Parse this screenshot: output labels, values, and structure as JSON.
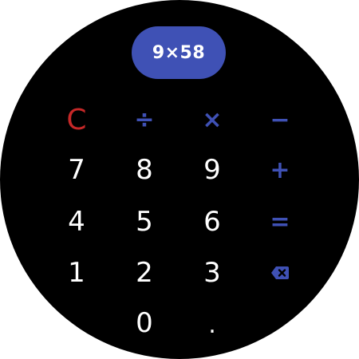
{
  "display": {
    "expression": "9×58"
  },
  "keys": {
    "clear": "C",
    "divide": "÷",
    "multiply": "×",
    "minus": "−",
    "plus": "+",
    "equals": "=",
    "dot": ".",
    "d0": "0",
    "d1": "1",
    "d2": "2",
    "d3": "3",
    "d4": "4",
    "d5": "5",
    "d6": "6",
    "d7": "7",
    "d8": "8",
    "d9": "9"
  },
  "icons": {
    "backspace": "backspace-icon"
  },
  "colors": {
    "background": "#000000",
    "accent": "#3f51b5",
    "clear": "#c62828",
    "digit": "#ffffff"
  }
}
